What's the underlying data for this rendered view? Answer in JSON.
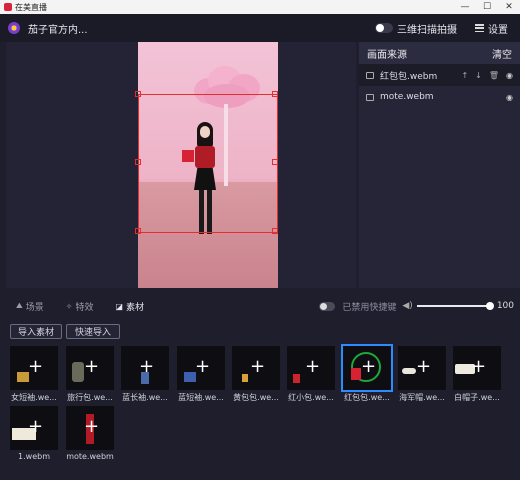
{
  "window": {
    "title": "在美直播",
    "min": "—",
    "max": "☐",
    "close": "✕"
  },
  "header": {
    "room_name": "茄子官方内...",
    "toggle_label": "三维扫描拍摄",
    "settings_label": "设置"
  },
  "sources": {
    "title": "画面来源",
    "clear_label": "清空",
    "items": [
      {
        "name": "红包包.webm",
        "active": true
      },
      {
        "name": "mote.webm",
        "active": false
      }
    ]
  },
  "tabs": [
    {
      "icon": "⛰",
      "label": "场景",
      "active": false
    },
    {
      "icon": "✧",
      "label": "特效",
      "active": false
    },
    {
      "icon": "◪",
      "label": "素材",
      "active": true
    }
  ],
  "hotkey": {
    "label": "已禁用快捷键",
    "enabled": false
  },
  "volume": {
    "value": "100",
    "level": 1.0
  },
  "buttons": {
    "import": "导入素材",
    "quick_import": "快速导入"
  },
  "assets": [
    {
      "label": "女短袖.we...",
      "art": "tshirt-female"
    },
    {
      "label": "旅行包.we...",
      "art": "backpack"
    },
    {
      "label": "蓝长袖.we...",
      "art": "longsleeve"
    },
    {
      "label": "蓝短袖.we...",
      "art": "tshirt-blue"
    },
    {
      "label": "黄包包.we...",
      "art": "bag-yellow"
    },
    {
      "label": "红小包.we...",
      "art": "bag-red-small"
    },
    {
      "label": "红包包.we...",
      "art": "bag-red",
      "active": true
    },
    {
      "label": "海军帽.we...",
      "art": "cap-navy"
    },
    {
      "label": "白帽子.we...",
      "art": "cap-white"
    },
    {
      "label": "1.webm",
      "art": "box"
    },
    {
      "label": "mote.webm",
      "art": "model"
    }
  ],
  "colors": {
    "accent": "#2b8cff",
    "selection": "#e23030",
    "ring": "#1fa83a",
    "background": "#1e1e2c"
  }
}
